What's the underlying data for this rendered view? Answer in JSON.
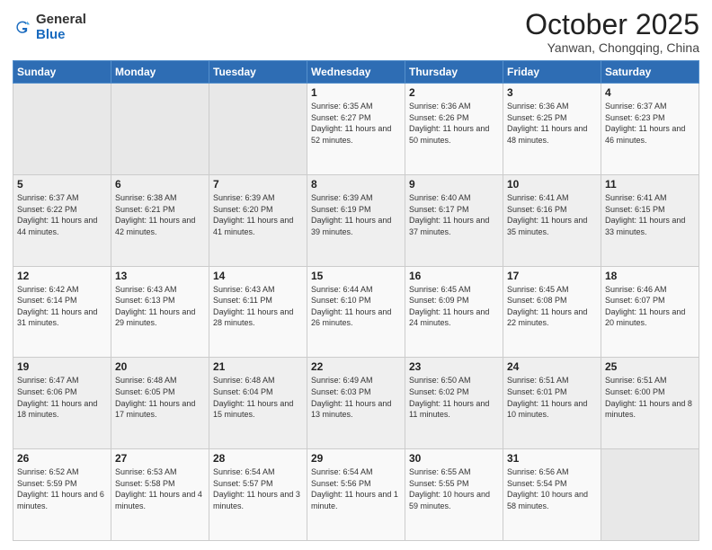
{
  "header": {
    "logo_general": "General",
    "logo_blue": "Blue",
    "month_title": "October 2025",
    "subtitle": "Yanwan, Chongqing, China"
  },
  "weekdays": [
    "Sunday",
    "Monday",
    "Tuesday",
    "Wednesday",
    "Thursday",
    "Friday",
    "Saturday"
  ],
  "weeks": [
    [
      {
        "day": "",
        "sunrise": "",
        "sunset": "",
        "daylight": ""
      },
      {
        "day": "",
        "sunrise": "",
        "sunset": "",
        "daylight": ""
      },
      {
        "day": "",
        "sunrise": "",
        "sunset": "",
        "daylight": ""
      },
      {
        "day": "1",
        "sunrise": "Sunrise: 6:35 AM",
        "sunset": "Sunset: 6:27 PM",
        "daylight": "Daylight: 11 hours and 52 minutes."
      },
      {
        "day": "2",
        "sunrise": "Sunrise: 6:36 AM",
        "sunset": "Sunset: 6:26 PM",
        "daylight": "Daylight: 11 hours and 50 minutes."
      },
      {
        "day": "3",
        "sunrise": "Sunrise: 6:36 AM",
        "sunset": "Sunset: 6:25 PM",
        "daylight": "Daylight: 11 hours and 48 minutes."
      },
      {
        "day": "4",
        "sunrise": "Sunrise: 6:37 AM",
        "sunset": "Sunset: 6:23 PM",
        "daylight": "Daylight: 11 hours and 46 minutes."
      }
    ],
    [
      {
        "day": "5",
        "sunrise": "Sunrise: 6:37 AM",
        "sunset": "Sunset: 6:22 PM",
        "daylight": "Daylight: 11 hours and 44 minutes."
      },
      {
        "day": "6",
        "sunrise": "Sunrise: 6:38 AM",
        "sunset": "Sunset: 6:21 PM",
        "daylight": "Daylight: 11 hours and 42 minutes."
      },
      {
        "day": "7",
        "sunrise": "Sunrise: 6:39 AM",
        "sunset": "Sunset: 6:20 PM",
        "daylight": "Daylight: 11 hours and 41 minutes."
      },
      {
        "day": "8",
        "sunrise": "Sunrise: 6:39 AM",
        "sunset": "Sunset: 6:19 PM",
        "daylight": "Daylight: 11 hours and 39 minutes."
      },
      {
        "day": "9",
        "sunrise": "Sunrise: 6:40 AM",
        "sunset": "Sunset: 6:17 PM",
        "daylight": "Daylight: 11 hours and 37 minutes."
      },
      {
        "day": "10",
        "sunrise": "Sunrise: 6:41 AM",
        "sunset": "Sunset: 6:16 PM",
        "daylight": "Daylight: 11 hours and 35 minutes."
      },
      {
        "day": "11",
        "sunrise": "Sunrise: 6:41 AM",
        "sunset": "Sunset: 6:15 PM",
        "daylight": "Daylight: 11 hours and 33 minutes."
      }
    ],
    [
      {
        "day": "12",
        "sunrise": "Sunrise: 6:42 AM",
        "sunset": "Sunset: 6:14 PM",
        "daylight": "Daylight: 11 hours and 31 minutes."
      },
      {
        "day": "13",
        "sunrise": "Sunrise: 6:43 AM",
        "sunset": "Sunset: 6:13 PM",
        "daylight": "Daylight: 11 hours and 29 minutes."
      },
      {
        "day": "14",
        "sunrise": "Sunrise: 6:43 AM",
        "sunset": "Sunset: 6:11 PM",
        "daylight": "Daylight: 11 hours and 28 minutes."
      },
      {
        "day": "15",
        "sunrise": "Sunrise: 6:44 AM",
        "sunset": "Sunset: 6:10 PM",
        "daylight": "Daylight: 11 hours and 26 minutes."
      },
      {
        "day": "16",
        "sunrise": "Sunrise: 6:45 AM",
        "sunset": "Sunset: 6:09 PM",
        "daylight": "Daylight: 11 hours and 24 minutes."
      },
      {
        "day": "17",
        "sunrise": "Sunrise: 6:45 AM",
        "sunset": "Sunset: 6:08 PM",
        "daylight": "Daylight: 11 hours and 22 minutes."
      },
      {
        "day": "18",
        "sunrise": "Sunrise: 6:46 AM",
        "sunset": "Sunset: 6:07 PM",
        "daylight": "Daylight: 11 hours and 20 minutes."
      }
    ],
    [
      {
        "day": "19",
        "sunrise": "Sunrise: 6:47 AM",
        "sunset": "Sunset: 6:06 PM",
        "daylight": "Daylight: 11 hours and 18 minutes."
      },
      {
        "day": "20",
        "sunrise": "Sunrise: 6:48 AM",
        "sunset": "Sunset: 6:05 PM",
        "daylight": "Daylight: 11 hours and 17 minutes."
      },
      {
        "day": "21",
        "sunrise": "Sunrise: 6:48 AM",
        "sunset": "Sunset: 6:04 PM",
        "daylight": "Daylight: 11 hours and 15 minutes."
      },
      {
        "day": "22",
        "sunrise": "Sunrise: 6:49 AM",
        "sunset": "Sunset: 6:03 PM",
        "daylight": "Daylight: 11 hours and 13 minutes."
      },
      {
        "day": "23",
        "sunrise": "Sunrise: 6:50 AM",
        "sunset": "Sunset: 6:02 PM",
        "daylight": "Daylight: 11 hours and 11 minutes."
      },
      {
        "day": "24",
        "sunrise": "Sunrise: 6:51 AM",
        "sunset": "Sunset: 6:01 PM",
        "daylight": "Daylight: 11 hours and 10 minutes."
      },
      {
        "day": "25",
        "sunrise": "Sunrise: 6:51 AM",
        "sunset": "Sunset: 6:00 PM",
        "daylight": "Daylight: 11 hours and 8 minutes."
      }
    ],
    [
      {
        "day": "26",
        "sunrise": "Sunrise: 6:52 AM",
        "sunset": "Sunset: 5:59 PM",
        "daylight": "Daylight: 11 hours and 6 minutes."
      },
      {
        "day": "27",
        "sunrise": "Sunrise: 6:53 AM",
        "sunset": "Sunset: 5:58 PM",
        "daylight": "Daylight: 11 hours and 4 minutes."
      },
      {
        "day": "28",
        "sunrise": "Sunrise: 6:54 AM",
        "sunset": "Sunset: 5:57 PM",
        "daylight": "Daylight: 11 hours and 3 minutes."
      },
      {
        "day": "29",
        "sunrise": "Sunrise: 6:54 AM",
        "sunset": "Sunset: 5:56 PM",
        "daylight": "Daylight: 11 hours and 1 minute."
      },
      {
        "day": "30",
        "sunrise": "Sunrise: 6:55 AM",
        "sunset": "Sunset: 5:55 PM",
        "daylight": "Daylight: 10 hours and 59 minutes."
      },
      {
        "day": "31",
        "sunrise": "Sunrise: 6:56 AM",
        "sunset": "Sunset: 5:54 PM",
        "daylight": "Daylight: 10 hours and 58 minutes."
      },
      {
        "day": "",
        "sunrise": "",
        "sunset": "",
        "daylight": ""
      }
    ]
  ]
}
